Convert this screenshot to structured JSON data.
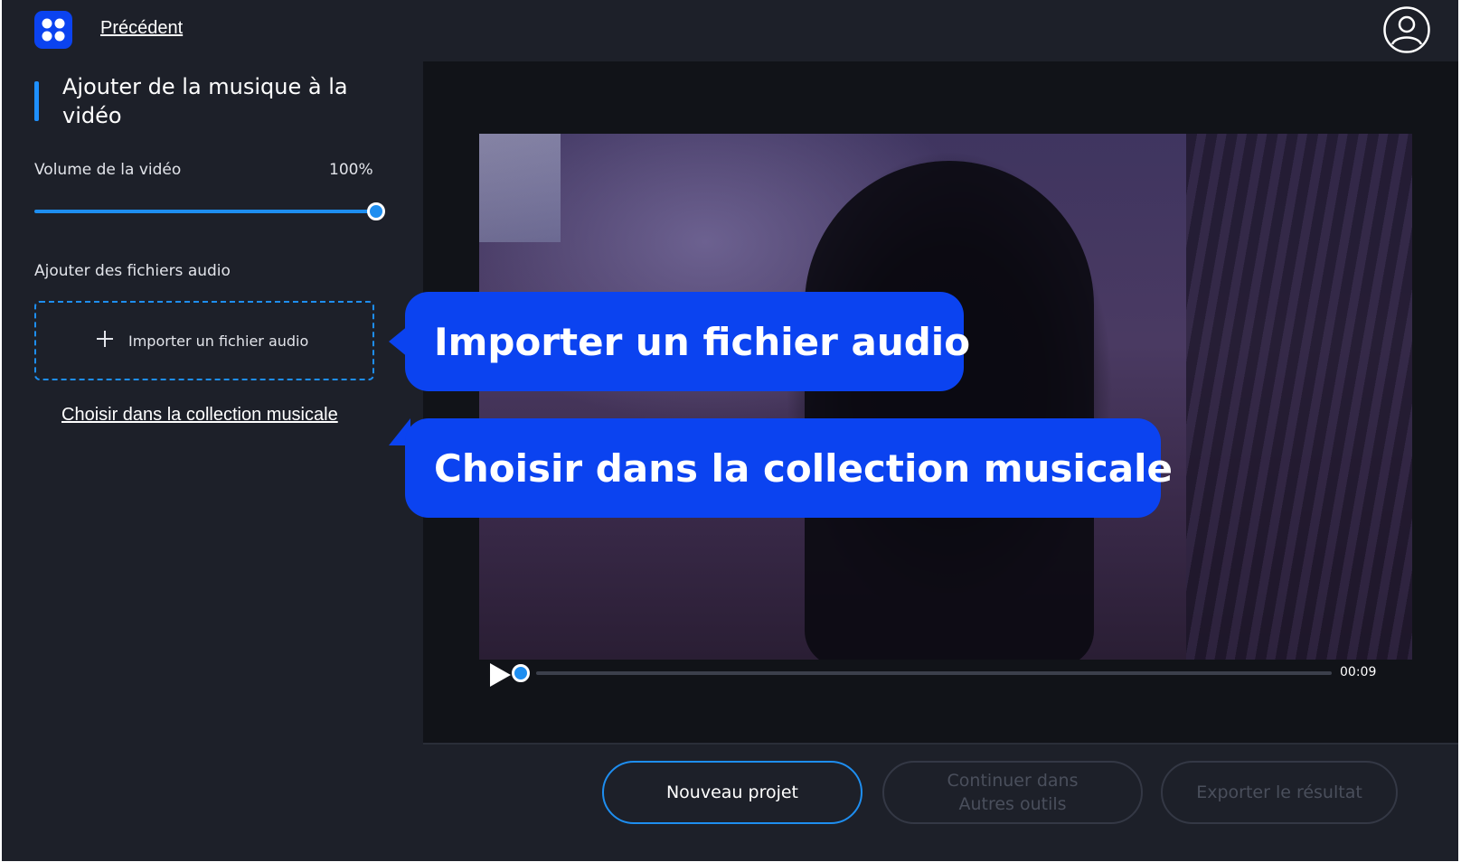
{
  "header": {
    "back_label": "Précédent"
  },
  "sidebar": {
    "title": "Ajouter de la musique à la vidéo",
    "volume_label": "Volume de la vidéo",
    "volume_value": "100%",
    "volume_level": 1.0,
    "audio_section_label": "Ajouter des fichiers audio",
    "import_label": "Importer un fichier audio",
    "collection_link": "Choisir dans la collection musicale"
  },
  "player": {
    "time": "00:09",
    "progress": 0.0
  },
  "footer": {
    "new_project": "Nouveau projet",
    "continue_line1": "Continuer dans",
    "continue_line2": "Autres outils",
    "export": "Exporter le résultat"
  },
  "callouts": {
    "import": "Importer un fichier audio",
    "collection": "Choisir dans la collection musicale"
  },
  "colors": {
    "accent": "#1e8ef0",
    "callout": "#0b43f0",
    "background": "#1d2029",
    "stage": "#111318"
  },
  "icons": [
    "app-logo-icon",
    "user-avatar-icon",
    "plus-icon",
    "play-icon"
  ]
}
